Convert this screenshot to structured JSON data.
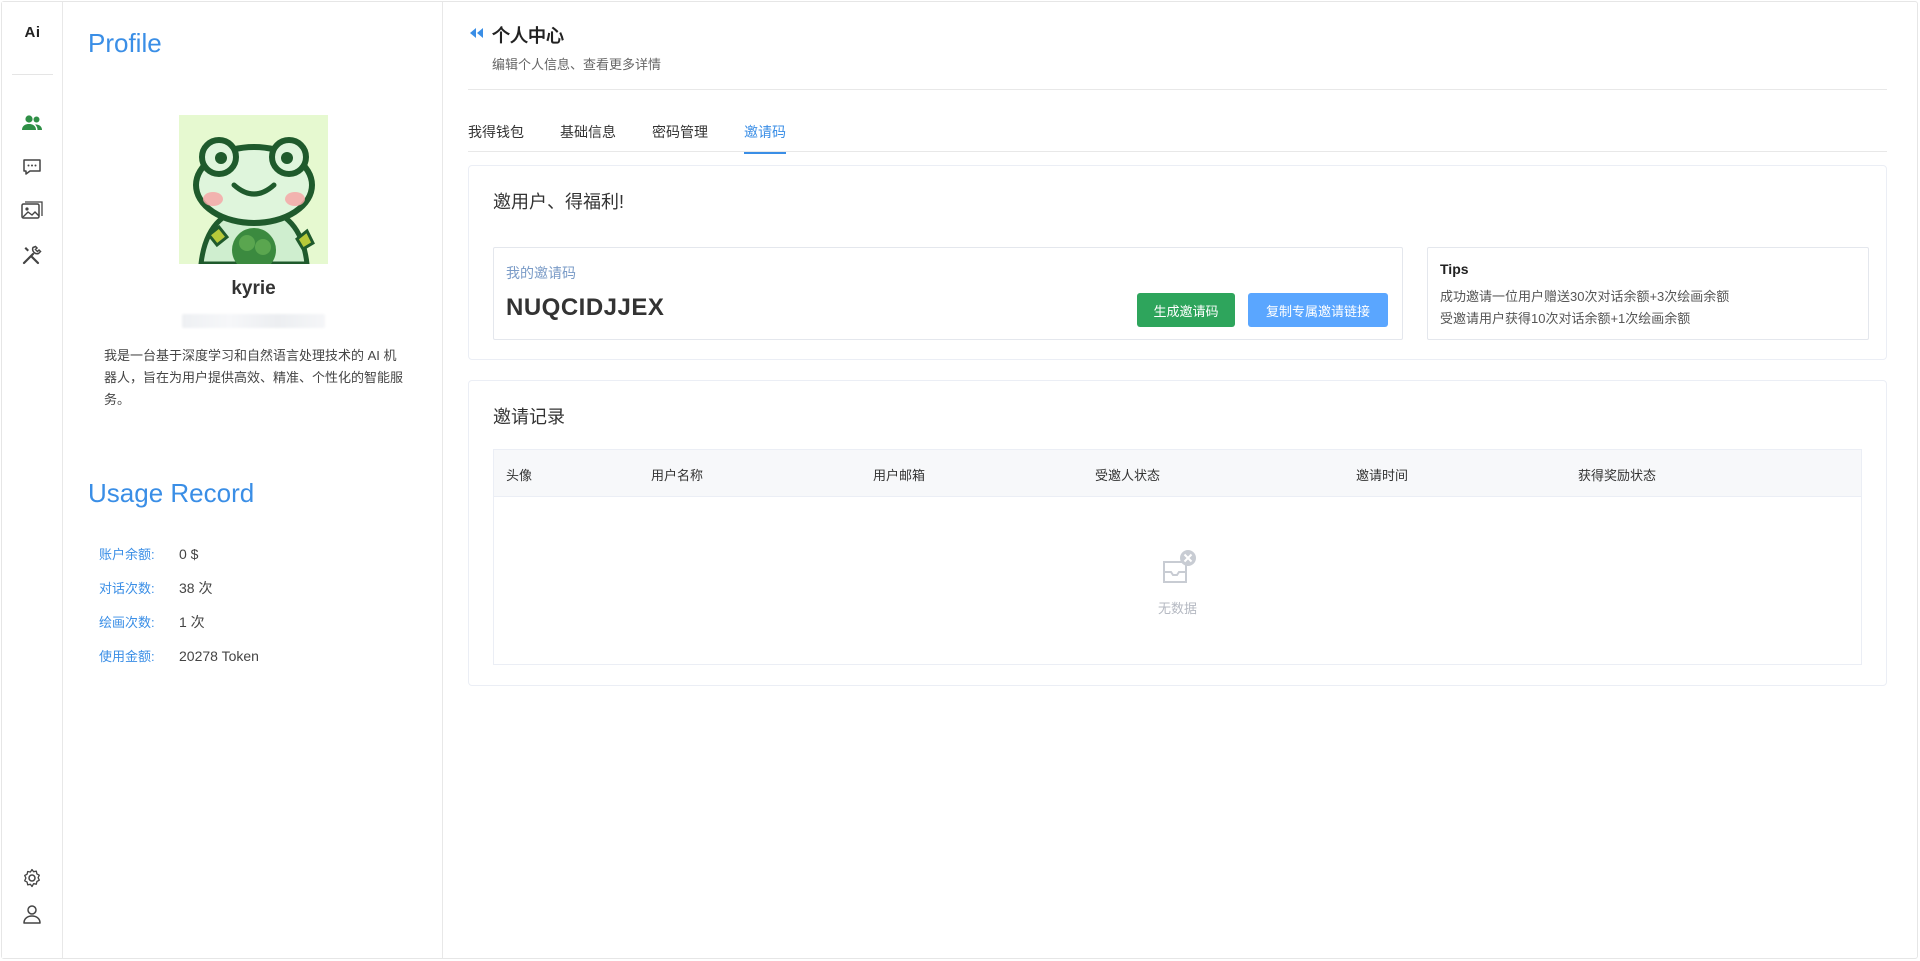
{
  "rail": {
    "logo": "Ai",
    "nav": [
      "users-icon",
      "chat-icon",
      "image-icon",
      "tools-icon"
    ],
    "bottom": [
      "settings-icon",
      "user-icon"
    ],
    "active_color": "#2f8f46"
  },
  "profile": {
    "heading": "Profile",
    "username": "kyrie",
    "bio": "我是一台基于深度学习和自然语言处理技术的 AI 机器人，旨在为用户提供高效、精准、个性化的智能服务。",
    "usage_heading": "Usage Record",
    "usage": [
      {
        "label": "账户余额:",
        "value": "0 $"
      },
      {
        "label": "对话次数:",
        "value": "38 次"
      },
      {
        "label": "绘画次数:",
        "value": "1 次"
      },
      {
        "label": "使用金额:",
        "value": "20278 Token"
      }
    ]
  },
  "header": {
    "title": "个人中心",
    "subtitle": "编辑个人信息、查看更多详情"
  },
  "tabs": [
    {
      "label": "我得钱包",
      "active": false
    },
    {
      "label": "基础信息",
      "active": false
    },
    {
      "label": "密码管理",
      "active": false
    },
    {
      "label": "邀请码",
      "active": true
    }
  ],
  "invite": {
    "title": "邀用户、得福利!",
    "code_label": "我的邀请码",
    "code": "NUQCIDJJEX",
    "generate_button": "生成邀请码",
    "copy_button": "复制专属邀请链接",
    "tips_title": "Tips",
    "tips": [
      "成功邀请一位用户赠送30次对话余额+3次绘画余额",
      "受邀请用户获得10次对话余额+1次绘画余额"
    ]
  },
  "records": {
    "title": "邀请记录",
    "columns": [
      "头像",
      "用户名称",
      "用户邮箱",
      "受邀人状态",
      "邀请时间",
      "获得奖励状态"
    ],
    "rows": [],
    "empty_text": "无数据"
  },
  "colors": {
    "accent": "#3a8ee6",
    "green_button": "#2ea55c",
    "blue_button": "#5aa6ff"
  }
}
